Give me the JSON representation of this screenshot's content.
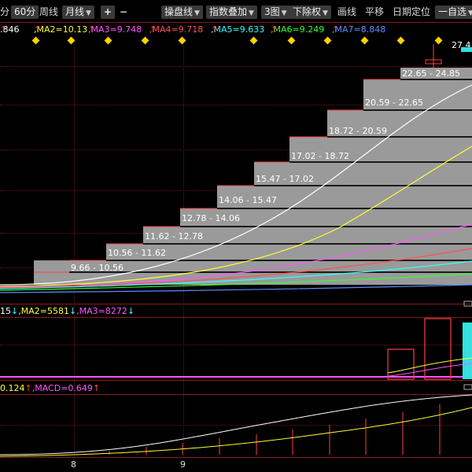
{
  "toolbar": {
    "items": [
      {
        "label": "分",
        "style": "plain"
      },
      {
        "label": "60分",
        "style": "box"
      },
      {
        "label": "周线",
        "style": "plain"
      },
      {
        "label": "月线",
        "style": "box",
        "dropdown": true
      },
      {
        "label": "+",
        "style": "box"
      },
      {
        "label": "−",
        "style": "plain"
      },
      {
        "label": "操盘线",
        "style": "box",
        "dropdown": true
      },
      {
        "label": "指数叠加",
        "style": "box",
        "dropdown": true
      },
      {
        "label": "3图",
        "style": "box",
        "dropdown": true
      },
      {
        "label": "下除权",
        "style": "box",
        "dropdown": true
      },
      {
        "label": "画线",
        "style": "plain"
      },
      {
        "label": "平移",
        "style": "plain"
      },
      {
        "label": "日期定位",
        "style": "plain"
      },
      {
        "label": "一自选",
        "style": "box",
        "dropdown": true
      }
    ]
  },
  "ma": [
    {
      "text": ".846",
      "arrow": "↑",
      "color": "#ffffff",
      "arrow_color": "#ff4040"
    },
    {
      "text": ",MA2=10.13",
      "arrow": "↑",
      "color": "#ffff33",
      "arrow_color": "#ff4040"
    },
    {
      "text": ",MA3=9.748",
      "arrow": "↑",
      "color": "#ff55ff",
      "arrow_color": "#ff4040"
    },
    {
      "text": ",MA4=9.718",
      "arrow": "↑",
      "color": "#ff5050",
      "arrow_color": "#ff4040"
    },
    {
      "text": ",MA5=9.633",
      "arrow": "↑",
      "color": "#33ffff",
      "arrow_color": "#ff4040"
    },
    {
      "text": ",MA6=9.249",
      "arrow": "↑",
      "color": "#33ff33",
      "arrow_color": "#ff4040"
    },
    {
      "text": ",MA7=8.848",
      "arrow": "↑",
      "color": "#5a8cff",
      "arrow_color": "#ff4040"
    }
  ],
  "volume_label": {
    "parts": [
      {
        "text": "15",
        "color": "#ffffff"
      },
      {
        "text": "↓",
        "color": "#33ffff"
      },
      {
        "text": ",MA2=5581",
        "color": "#ffff33"
      },
      {
        "text": "↓",
        "color": "#33ffff"
      },
      {
        "text": ",MA3=8272",
        "color": "#ff55ff"
      },
      {
        "text": "↓",
        "color": "#33ffff"
      }
    ]
  },
  "macd_label": {
    "parts": [
      {
        "text": "0.124",
        "color": "#ffff33"
      },
      {
        "text": "↑",
        "color": "#ff4040"
      },
      {
        "text": ",MACD=0.649",
        "color": "#ff55ff"
      },
      {
        "text": "↑",
        "color": "#ff4040"
      }
    ]
  },
  "price_box_labels": [
    "9.66 - 10.56",
    "10.56 - 11.62",
    "11.62 - 12.78",
    "12.78 - 14.06",
    "14.06 - 15.47",
    "15.47 - 17.02",
    "17.02 - 18.72",
    "18.72 - 20.59",
    "20.59 - 22.65",
    "22.65 - 24.85"
  ],
  "last_price": "27.4",
  "x_ticks": [
    "8",
    "9"
  ],
  "colors": {
    "grid": "#8b1a1a",
    "box_fill": "#9a9a9a",
    "marker": "#ffd200",
    "accent_cyan": "#34e0e0"
  }
}
